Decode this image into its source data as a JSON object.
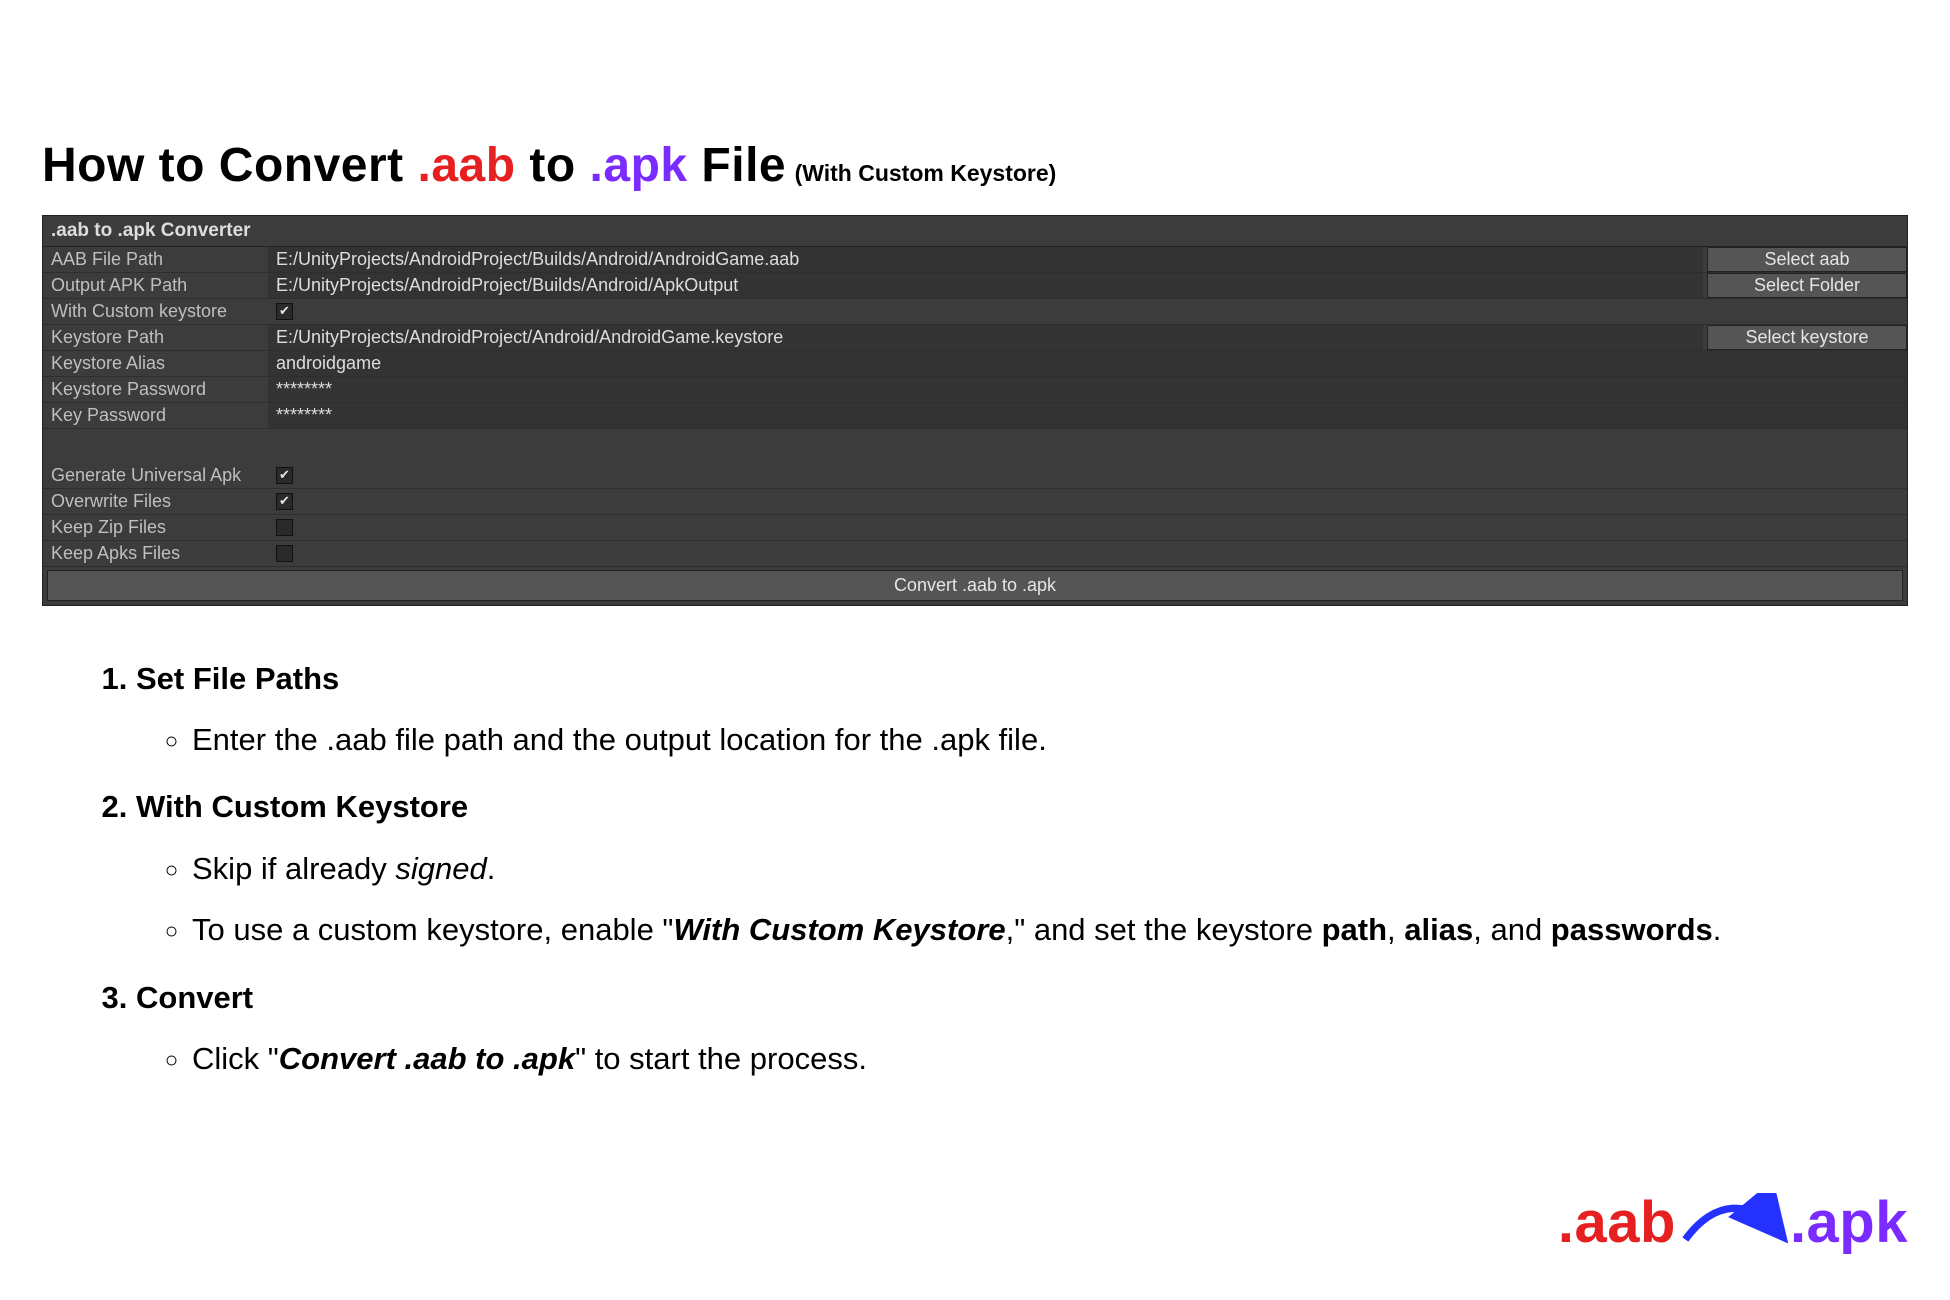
{
  "title": {
    "p1": "How to Convert ",
    "aab": ".aab",
    "p2": " to ",
    "apk": ".apk",
    "p3": " File",
    "suffix": "(With Custom Keystore)"
  },
  "panel": {
    "header": ".aab to .apk Converter",
    "labels": {
      "aab_path": "AAB File Path",
      "out_path": "Output APK Path",
      "with_keystore": "With Custom keystore",
      "keystore_path": "Keystore Path",
      "keystore_alias": "Keystore Alias",
      "keystore_password": "Keystore Password",
      "key_password": "Key Password",
      "gen_universal": "Generate Universal Apk",
      "overwrite": "Overwrite Files",
      "keep_zip": "Keep Zip Files",
      "keep_apks": "Keep Apks Files"
    },
    "values": {
      "aab_path": "E:/UnityProjects/AndroidProject/Builds/Android/AndroidGame.aab",
      "out_path": "E:/UnityProjects/AndroidProject/Builds/Android/ApkOutput",
      "keystore_path": "E:/UnityProjects/AndroidProject/Android/AndroidGame.keystore",
      "keystore_alias": "androidgame",
      "keystore_password": "********",
      "key_password": "********"
    },
    "buttons": {
      "select_aab": "Select aab",
      "select_folder": "Select Folder",
      "select_keystore": "Select keystore",
      "convert": "Convert .aab to .apk"
    },
    "checks": {
      "with_keystore": true,
      "gen_universal": true,
      "overwrite": true,
      "keep_zip": false,
      "keep_apks": false
    }
  },
  "instructions": {
    "step1": {
      "title": "Set File Paths",
      "b1": "Enter the .aab file path and the output location for the .apk file."
    },
    "step2": {
      "title": "With Custom Keystore",
      "b1_a": "Skip if already ",
      "b1_i": "signed",
      "b1_c": ".",
      "b2_a": "To use a custom keystore, enable \"",
      "b2_b": "With Custom Keystore",
      "b2_c": ",\" and set the keystore ",
      "b2_d": "path",
      "b2_e": ", ",
      "b2_f": "alias",
      "b2_g": ", and ",
      "b2_h": "passwords",
      "b2_i": "."
    },
    "step3": {
      "title": "Convert",
      "b1_a": "Click \"",
      "b1_b": "Convert .aab to .apk",
      "b1_c": "\" to start the process."
    }
  },
  "footer": {
    "aab": ".aab",
    "apk": ".apk"
  }
}
